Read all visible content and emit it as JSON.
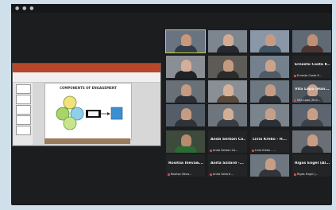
{
  "meeting": {
    "slide_title": "COMPONENTS OF ENGAGEMENT"
  },
  "participants": [
    {
      "name": "",
      "big_label": "",
      "bg": "#6a7380",
      "skin": "#c7987c",
      "shirt": "#2f3b4a"
    },
    {
      "name": "",
      "big_label": "",
      "bg": "#7d858e",
      "skin": "#d3ab95",
      "shirt": "#262a30"
    },
    {
      "name": "",
      "big_label": "",
      "bg": "#8997a7",
      "skin": "#c79b83",
      "shirt": "#415567"
    },
    {
      "name": "",
      "big_label": "",
      "bg": "#606a74",
      "skin": "#c08f76",
      "shirt": "#4b3434"
    },
    {
      "name": "",
      "big_label": "",
      "bg": "#8b8f95",
      "skin": "#d4ae98",
      "shirt": "#1f2328"
    },
    {
      "name": "",
      "big_label": "",
      "bg": "#5e5a55",
      "skin": "#c49b80",
      "shirt": "#2b2b2b"
    },
    {
      "name": "",
      "big_label": "",
      "bg": "#74808e",
      "skin": "#cba28a",
      "shirt": "#4f5b66"
    },
    {
      "name": "Ernesto Costa K...",
      "big_label": "Ernesto Costa K...",
      "bg": "#232425",
      "skin": "",
      "shirt": ""
    },
    {
      "name": "",
      "big_label": "",
      "bg": "#6a7078",
      "skin": "#c49a82",
      "shirt": "#2c3036"
    },
    {
      "name": "",
      "big_label": "",
      "bg": "#8a8f96",
      "skin": "#d6b29c",
      "shirt": "#5a4a3c"
    },
    {
      "name": "",
      "big_label": "",
      "bg": "#6e7882",
      "skin": "#c49c84",
      "shirt": "#2d3034"
    },
    {
      "name": "Vita Lopo (Hun...",
      "big_label": "Vita Lopo (Han...",
      "bg": "#4e565e",
      "skin": "#c7a08a",
      "shirt": "#3a3f45"
    },
    {
      "name": "",
      "big_label": "",
      "bg": "#555e68",
      "skin": "#c59b82",
      "shirt": "#2f3338"
    },
    {
      "name": "",
      "big_label": "",
      "bg": "#6f757d",
      "skin": "#d2ae97",
      "shirt": "#383d44"
    },
    {
      "name": "",
      "big_label": "",
      "bg": "#7b848d",
      "skin": "#c5a088",
      "shirt": "#2b3036"
    },
    {
      "name": "",
      "big_label": "",
      "bg": "#5c6570",
      "skin": "#c89f86",
      "shirt": "#3d4249"
    },
    {
      "name": "",
      "big_label": "",
      "bg": "#3d4a3c",
      "skin": "#b88b6e",
      "shirt": "#2d6b34"
    },
    {
      "name": "Anda Serban Ca...",
      "big_label": "Anda Serban Ca...",
      "bg": "#232425",
      "skin": "",
      "shirt": ""
    },
    {
      "name": "Livia Kreko - ...",
      "big_label": "Livia Kreko - H...",
      "bg": "#232425",
      "skin": "",
      "shirt": ""
    },
    {
      "name": "",
      "big_label": "",
      "bg": "#6a6f75",
      "skin": "#c99c84",
      "shirt": "#2a2d31"
    },
    {
      "name": "Rositsa Ilieva...",
      "big_label": "Rositsa Ilieva&...",
      "bg": "#232425",
      "skin": "",
      "shirt": ""
    },
    {
      "name": "Anita Szilard ...",
      "big_label": "Anita Szilard -...",
      "bg": "#232425",
      "skin": "",
      "shirt": ""
    },
    {
      "name": "",
      "big_label": "",
      "bg": "#6e7780",
      "skin": "#c79d85",
      "shirt": "#313539"
    },
    {
      "name": "Rigas Engel (...",
      "big_label": "Rigas Engel (Al...",
      "bg": "#232425",
      "skin": "",
      "shirt": ""
    }
  ]
}
